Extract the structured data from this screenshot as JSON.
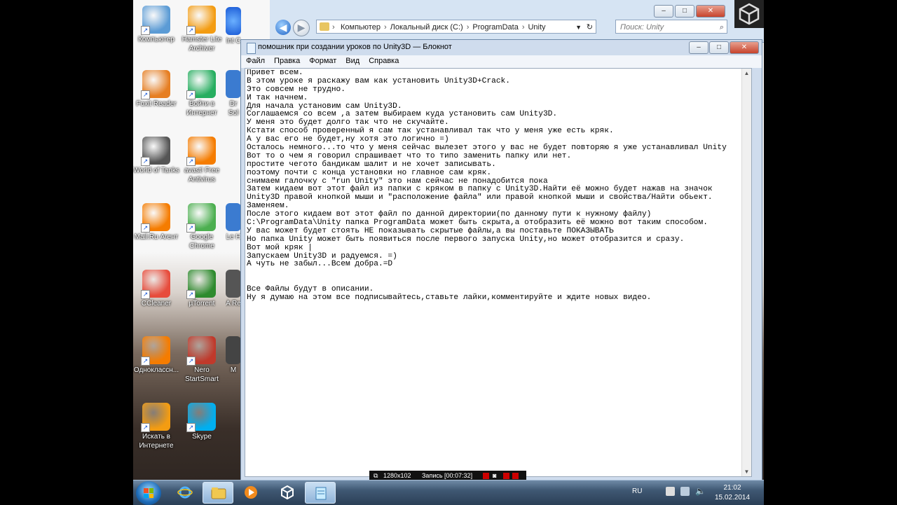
{
  "desktop": {
    "icons": [
      {
        "label": "Компьютер",
        "icon": "computer-icon",
        "color": "#5b9bd5"
      },
      {
        "label": "Hamster Lite Archiver",
        "icon": "hamster-archiver-icon",
        "color": "#f39c12"
      },
      {
        "label": "Foxit Reader",
        "icon": "foxit-reader-icon",
        "color": "#e67e22"
      },
      {
        "label": "Войти в Интернет",
        "icon": "internet-globe-icon",
        "color": "#27ae60"
      },
      {
        "label": "World of Tanks",
        "icon": "world-of-tanks-icon",
        "color": "#555555"
      },
      {
        "label": "avast! Free Antivirus",
        "icon": "avast-icon",
        "color": "#f57c00"
      },
      {
        "label": "Mail.Ru Агент",
        "icon": "mailru-agent-icon",
        "color": "#f57c00"
      },
      {
        "label": "Google Chrome",
        "icon": "chrome-icon",
        "color": "#4caf50"
      },
      {
        "label": "CCleaner",
        "icon": "ccleaner-icon",
        "color": "#e74c3c"
      },
      {
        "label": "µTorrent",
        "icon": "utorrent-icon",
        "color": "#2e8b2e"
      },
      {
        "label": "Одноклассн...",
        "icon": "odnoklassniki-icon",
        "color": "#f57c00"
      },
      {
        "label": "Nero StartSmart",
        "icon": "nero-icon",
        "color": "#c0392b"
      },
      {
        "label": "Искать в Интернете",
        "icon": "search-internet-icon",
        "color": "#f39c12"
      },
      {
        "label": "Skype",
        "icon": "skype-icon",
        "color": "#00aff0"
      }
    ],
    "partial_labels": [
      "Int C",
      "Dr Sol",
      "Le H",
      "A Re",
      "M"
    ]
  },
  "explorer": {
    "path": [
      "Компьютер",
      "Локальный диск (C:)",
      "ProgramData",
      "Unity"
    ],
    "search_placeholder": "Поиск: Unity"
  },
  "notepad": {
    "title": "помошник при создании уроков по Unity3D — Блокнот",
    "menu": [
      "Файл",
      "Правка",
      "Формат",
      "Вид",
      "Справка"
    ],
    "lines": [
      "Привет всем.",
      "В этом уроке я раскажу вам как установить Unity3D+Crack.",
      "Это совсем не трудно.",
      "И так начнем.",
      "Для начала установим сам Unity3D.",
      "Соглашаемся со всем ,а затем выбираем куда установить сам Unity3D.",
      "У меня это будет долго так что не скучайте.",
      "Кстати способ проверенный я сам так устанавливал так что у меня уже есть кряк.",
      "А у вас его не будет,ну хотя это логично =)",
      "Осталось немного...то что у меня сейчас вылезет этого у вас не будет повторяю я уже устанавливал Unity",
      "Вот то о чем я говорил спрашивает что то типо заменить папку или нет.",
      "простите чегото бандикам шалит и не хочет записывать.",
      "поэтому почти с конца установки но главное сам кряк.",
      "снимаем галочку с \"run Unity\" это нам сейчас не понадобится пока",
      "Затем кидаем вот этот файл из папки с кряком в папку с Unity3D.Найти её можно будет нажав на значок",
      "Unity3D правой кнопкой мыши и \"расположение файла\" или правой кнопкой мыши и свойства/Найти обьект.",
      "Заменяем.",
      "После этого кидаем вот этот файл по данной директории(по данному пути к нужному файлу)",
      "C:\\ProgramData\\Unity папка ProgramData может быть скрыта,а отобразить её можно вот таким способом.",
      "У вас может будет стоять НЕ показывать скрытые файлы,а вы поставьте ПОКАЗЫВАТЬ",
      "Но папка Unity может быть появиться после первого запуска Unity,но может отобразится и сразу.",
      "Вот мой кряк |",
      "Запускаем Unity3D и радуемся. =)",
      "А чуть не забыл...Всем добра.=D",
      "",
      "",
      "Все Файлы будут в описании.",
      "Ну я думаю на этом все подписывайтесь,ставьте лайки,комментируйте и ждите новых видео."
    ]
  },
  "recorder": {
    "resolution": "1280x102",
    "status": "Запись [00:07:32]"
  },
  "taskbar": {
    "lang": "RU",
    "time": "21:02",
    "date": "15.02.2014"
  },
  "colors": {
    "accent": "#1d6bb8",
    "taskbar": "#3f5873",
    "close": "#c7432c"
  }
}
